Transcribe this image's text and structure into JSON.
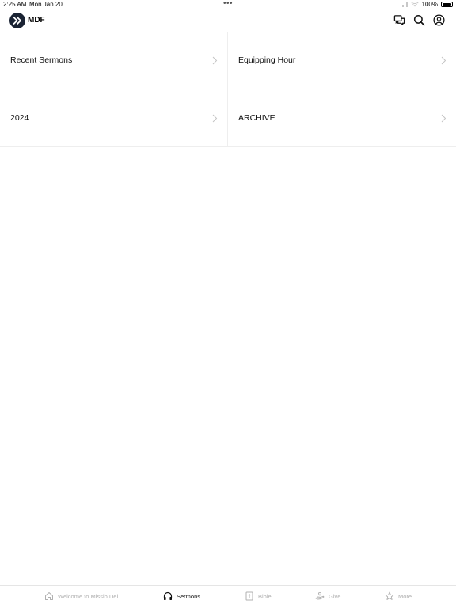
{
  "status_bar": {
    "time": "2:25 AM",
    "date": "Mon Jan 20",
    "multitask_dots": "•••",
    "battery": "100%"
  },
  "header": {
    "title": "MDF",
    "icons": [
      "logo-icon",
      "chat-icon",
      "search-icon",
      "profile-icon"
    ]
  },
  "menu": {
    "items": [
      {
        "label": "Recent Sermons"
      },
      {
        "label": "Equipping Hour"
      },
      {
        "label": "2024"
      },
      {
        "label": "ARCHIVE"
      }
    ]
  },
  "tabs": [
    {
      "label": "Welcome to Missio Dei",
      "icon": "home-icon",
      "active": false
    },
    {
      "label": "Sermons",
      "icon": "headphones-icon",
      "active": true
    },
    {
      "label": "Bible",
      "icon": "bible-icon",
      "active": false
    },
    {
      "label": "Give",
      "icon": "give-icon",
      "active": false
    },
    {
      "label": "More",
      "icon": "star-icon",
      "active": false
    }
  ],
  "colors": {
    "active_tab": "#111111",
    "inactive_tab": "#b0b0b0",
    "divider": "#eeeeee"
  }
}
